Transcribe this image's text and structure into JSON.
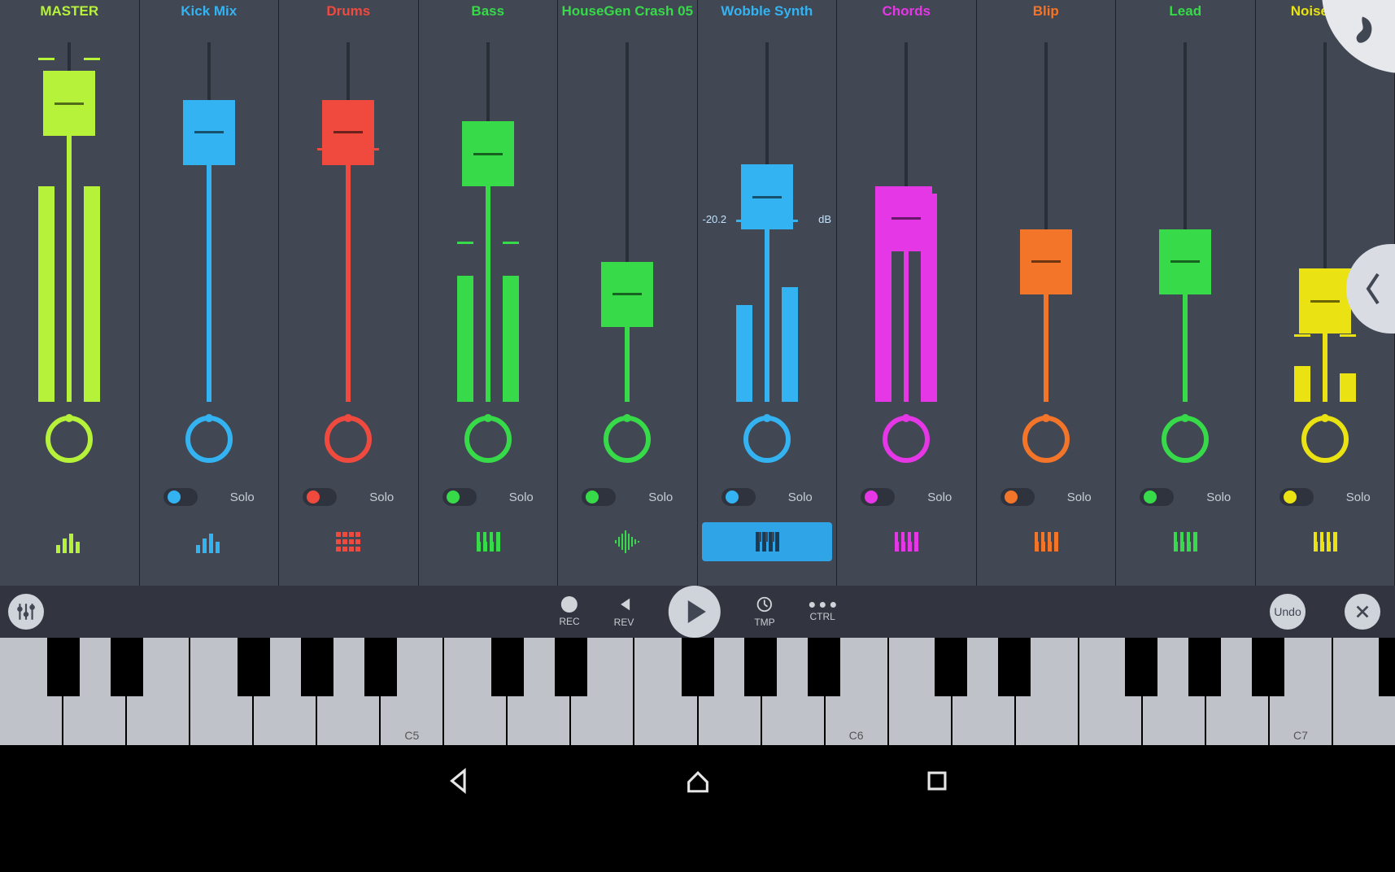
{
  "transport": {
    "rec": "REC",
    "rev": "REV",
    "tmp": "TMP",
    "ctrl": "CTRL",
    "undo": "Undo"
  },
  "solo_label": "Solo",
  "keyboard": {
    "white_keys": 22,
    "labels": {
      "6": "C5",
      "13": "C6",
      "20": "C7"
    },
    "black_after": [
      0,
      1,
      3,
      4,
      5,
      7,
      8,
      10,
      11,
      12,
      14,
      15,
      17,
      18,
      19,
      21
    ]
  },
  "wobble_db": {
    "value": "-20.2",
    "unit": "dB"
  },
  "channels": [
    {
      "id": "master",
      "name": "MASTER",
      "name_color": "#b6f23a",
      "color": "#b6f23a",
      "fader_pos": 0.92,
      "meter_l": 0.6,
      "meter_r": 0.6,
      "peak_l": 0.95,
      "peak_r": 0.95,
      "pan": 0.5,
      "show_solo": false,
      "icon": "eq",
      "selected": false
    },
    {
      "id": "kickmix",
      "name": "Kick Mix",
      "name_color": "#34b3f2",
      "color": "#34b3f2",
      "fader_pos": 0.84,
      "meter_l": null,
      "meter_r": null,
      "peak_l": null,
      "peak_r": null,
      "pan": 0.5,
      "show_solo": true,
      "icon": "eq",
      "selected": false
    },
    {
      "id": "drums",
      "name": "Drums",
      "name_color": "#f04a3f",
      "color": "#f04a3f",
      "fader_pos": 0.84,
      "meter_l": null,
      "meter_r": null,
      "peak_l": 0.7,
      "peak_r": 0.7,
      "pan": 0.5,
      "show_solo": true,
      "icon": "pads",
      "selected": false
    },
    {
      "id": "bass",
      "name": "Bass",
      "name_color": "#37da49",
      "color": "#37da49",
      "fader_pos": 0.78,
      "meter_l": 0.35,
      "meter_r": 0.35,
      "peak_l": 0.44,
      "peak_r": 0.44,
      "pan": 0.5,
      "show_solo": true,
      "icon": "keys",
      "selected": false
    },
    {
      "id": "crash",
      "name": "HouseGen Crash 05",
      "name_color": "#37da49",
      "color": "#37da49",
      "fader_pos": 0.39,
      "meter_l": null,
      "meter_r": null,
      "peak_l": null,
      "peak_r": null,
      "pan": 0.5,
      "show_solo": true,
      "icon": "wave",
      "selected": false
    },
    {
      "id": "wobble",
      "name": "Wobble Synth",
      "name_color": "#34b3f2",
      "color": "#34b3f2",
      "fader_pos": 0.66,
      "meter_l": 0.27,
      "meter_r": 0.32,
      "peak_l": 0.5,
      "peak_r": 0.5,
      "pan": 0.5,
      "show_solo": true,
      "icon": "keys",
      "selected": true,
      "show_db": true
    },
    {
      "id": "chords",
      "name": "Chords",
      "name_color": "#e637e6",
      "color": "#e637e6",
      "fader_pos": 0.6,
      "meter_l": 0.6,
      "meter_r": 0.58,
      "peak_l": 0.48,
      "peak_r": 0.48,
      "pan": 0.5,
      "show_solo": true,
      "icon": "keys",
      "selected": false
    },
    {
      "id": "blip",
      "name": "Blip",
      "name_color": "#f3752a",
      "color": "#f3752a",
      "fader_pos": 0.48,
      "meter_l": null,
      "meter_r": null,
      "peak_l": null,
      "peak_r": null,
      "pan": 0.5,
      "show_solo": true,
      "icon": "keys",
      "selected": false
    },
    {
      "id": "lead",
      "name": "Lead",
      "name_color": "#37da49",
      "color": "#37da49",
      "fader_pos": 0.48,
      "meter_l": null,
      "meter_r": null,
      "peak_l": null,
      "peak_r": null,
      "pan": 0.5,
      "show_solo": true,
      "icon": "keys",
      "selected": false
    },
    {
      "id": "noise",
      "name": "Noise SFX",
      "name_color": "#eae213",
      "color": "#eae213",
      "fader_pos": 0.37,
      "meter_l": 0.1,
      "meter_r": 0.08,
      "peak_l": 0.18,
      "peak_r": 0.18,
      "pan": 0.5,
      "show_solo": true,
      "icon": "keys",
      "selected": false
    }
  ]
}
